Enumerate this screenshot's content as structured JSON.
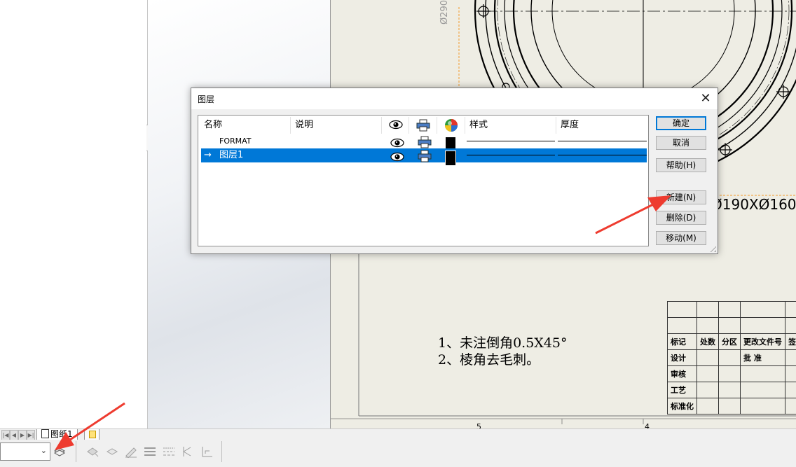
{
  "dialog": {
    "title": "图层",
    "columns": {
      "name": "名称",
      "description": "说明",
      "visible_icon": "eye-icon",
      "print_icon": "printer-icon",
      "color_icon": "color-wheel-icon",
      "style": "样式",
      "thickness": "厚度"
    },
    "layers": [
      {
        "name": "FORMAT",
        "current": false,
        "color": "#000000"
      },
      {
        "name": "图层1",
        "current": true,
        "current_marker": "→",
        "color": "#000000"
      }
    ],
    "buttons": {
      "ok": "确定",
      "cancel": "取消",
      "help": "帮助(H)",
      "new": "新建(N)",
      "delete": "删除(D)",
      "move": "移动(M)"
    }
  },
  "sheet_tabs": {
    "active": "图纸1"
  },
  "drawing": {
    "notes": [
      "1、未注倒角0.5X45°",
      "2、棱角去毛刺。"
    ],
    "dimension_text": "Ø190XØ160",
    "vertical_dimension": "Ø290",
    "scale_numbers": [
      "5",
      "4"
    ],
    "title_block": {
      "row1": [
        "标记",
        "处数",
        "分区",
        "更改文件号",
        "签"
      ],
      "row2": [
        "设计",
        "批 准"
      ],
      "row3": [
        "审核"
      ],
      "row4": [
        "工艺"
      ],
      "row5": [
        "标准化"
      ]
    }
  },
  "colors": {
    "selection": "#0078d7",
    "arrow": "#ee3b2f",
    "sheet_bg": "#eeede4"
  }
}
